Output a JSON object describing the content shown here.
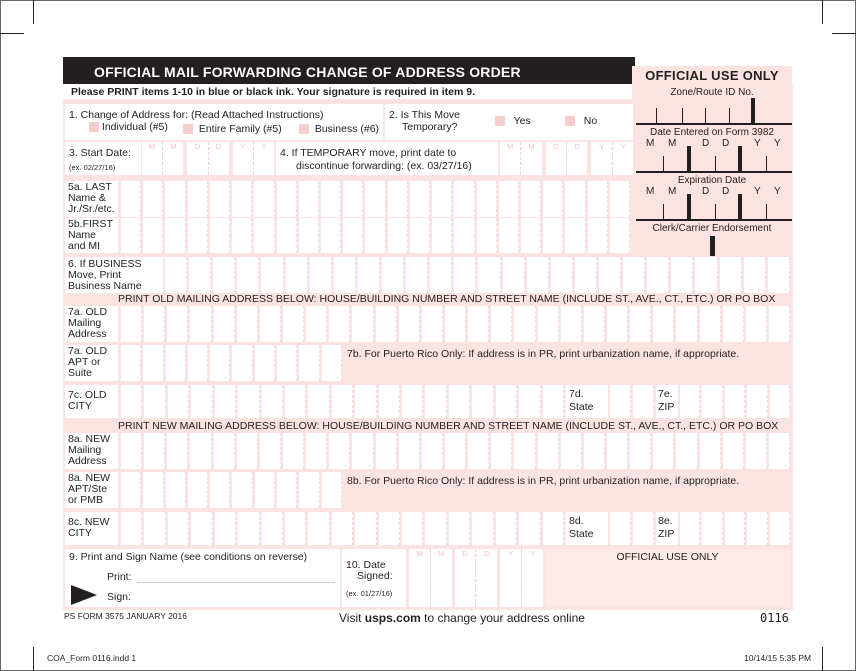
{
  "header": {
    "title": "OFFICIAL MAIL FORWARDING CHANGE OF ADDRESS ORDER",
    "instructions": "Please PRINT items 1-10 in blue or black ink. Your signature is required in item 9."
  },
  "official_use": {
    "title": "OFFICIAL USE ONLY",
    "zone_route": "Zone/Route ID No.",
    "date_entered": "Date Entered on Form 3982",
    "expiration": "Expiration Date",
    "clerk": "Clerk/Carrier Endorsement",
    "date_letters": [
      "M",
      "M",
      "D",
      "D",
      "Y",
      "Y"
    ]
  },
  "item1": {
    "label": "1. Change of Address for: (Read Attached Instructions)",
    "options": [
      "Individual (#5)",
      "Entire Family (#5)",
      "Business (#6)"
    ]
  },
  "item2": {
    "label_line1": "2. Is This Move",
    "label_line2": "Temporary?",
    "yes": "Yes",
    "no": "No"
  },
  "item3": {
    "label": "3. Start Date:",
    "example": "(ex. 02/27/16)",
    "placeholders": [
      "M",
      "M",
      "D",
      "D",
      "Y",
      "Y"
    ]
  },
  "item4": {
    "label_line1": "4.   If TEMPORARY move, print date to",
    "label_line2": "discontinue forwarding: (ex. 03/27/16)",
    "placeholders": [
      "M",
      "M",
      "D",
      "D",
      "Y",
      "Y"
    ]
  },
  "item5a": {
    "l1": "5a. LAST",
    "l2": "Name &",
    "l3": "Jr./Sr./etc."
  },
  "item5b": {
    "l1": "5b.FIRST",
    "l2": "Name",
    "l3": "and MI"
  },
  "item6": {
    "l1": "6. If BUSINESS",
    "l2": "Move, Print",
    "l3": "Business Name"
  },
  "old_header": "PRINT OLD MAILING ADDRESS BELOW: HOUSE/BUILDING NUMBER AND STREET NAME (INCLUDE ST., AVE., CT., ETC.) OR PO BOX",
  "item7a": {
    "l1": "7a. OLD",
    "l2": "Mailing",
    "l3": "Address"
  },
  "item7a_apt": {
    "l1": "7a. OLD",
    "l2": "APT or",
    "l3": "Suite"
  },
  "item7b": "7b. For Puerto Rico Only: If address is in PR, print urbanization name, if appropriate.",
  "item7c": {
    "l1": "7c. OLD",
    "l2": "CITY"
  },
  "item7d": {
    "l1": "7d.",
    "l2": "State"
  },
  "item7e": {
    "l1": "7e.",
    "l2": "ZIP"
  },
  "new_header": "PRINT NEW MAILING ADDRESS BELOW: HOUSE/BUILDING NUMBER AND STREET NAME (INCLUDE ST., AVE., CT., ETC.) OR PO BOX",
  "item8a": {
    "l1": "8a. NEW",
    "l2": "Mailing",
    "l3": "Address"
  },
  "item8a_apt": {
    "l1": "8a. NEW",
    "l2": "APT/Ste",
    "l3": "or PMB"
  },
  "item8b": "8b. For Puerto Rico Only: If address is in PR, print urbanization name, if appropriate.",
  "item8c": {
    "l1": "8c. NEW",
    "l2": "CITY"
  },
  "item8d": {
    "l1": "8d.",
    "l2": "State"
  },
  "item8e": {
    "l1": "8e.",
    "l2": "ZIP"
  },
  "item9": {
    "label": "9. Print and Sign Name (see conditions on reverse)",
    "print": "Print:",
    "sign": "Sign:"
  },
  "item10": {
    "l1": "10. Date",
    "l2": "Signed:",
    "example": "(ex. 01/27/16)",
    "placeholders": [
      "M",
      "M",
      "D",
      "D",
      "Y",
      "Y"
    ]
  },
  "bottom_official": "OFFICIAL USE ONLY",
  "footer": {
    "form_id": "PS FORM 3575  JANUARY 2016",
    "visit_pre": "Visit ",
    "visit_link": "usps.com",
    "visit_post": " to change your address online",
    "code": "0116"
  },
  "slug": {
    "file": "COA_Form 0116.indd   1",
    "timestamp": "10/14/15   5:35 PM"
  }
}
